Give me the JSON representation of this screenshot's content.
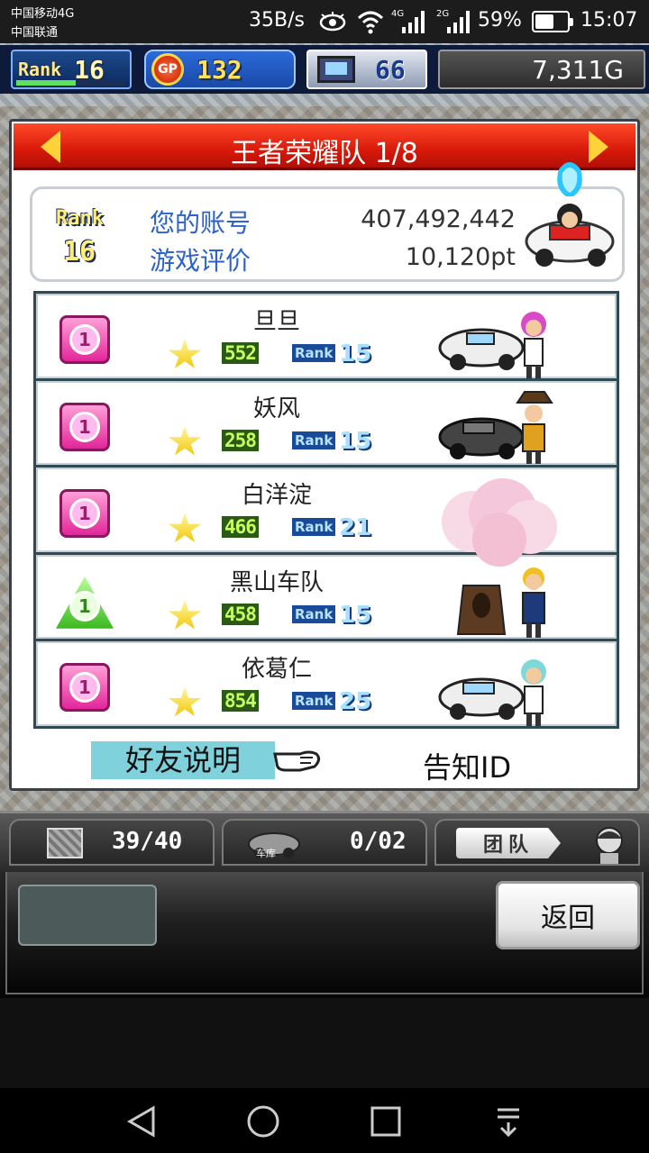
{
  "status_bar": {
    "carrier1": "中国移动4G",
    "carrier2": "中国联通",
    "net_speed": "35B/s",
    "battery_percent": "59%",
    "battery_level": 0.59,
    "clock": "15:07",
    "icons": [
      "eye-icon",
      "wifi-icon",
      "signal-4g-icon",
      "signal-2g-icon",
      "battery-icon"
    ]
  },
  "hud": {
    "rank_label": "Rank",
    "rank_value": "16",
    "rank_progress": 0.55,
    "gp_label": "GP",
    "gp_value": "132",
    "pc_value": "66",
    "gold": "7,311G"
  },
  "dialog": {
    "title": "王者荣耀队 1/8",
    "account": {
      "rank_label": "Rank",
      "rank_value": "16",
      "label_account": "您的账号",
      "label_rating": "游戏评价",
      "account_id": "407,492,442",
      "rating": "10,120pt"
    },
    "friends": [
      {
        "badge": "1",
        "badge_style": "pink",
        "name": "旦旦",
        "score": "552",
        "rank_label": "Rank",
        "rank": "15"
      },
      {
        "badge": "1",
        "badge_style": "pink",
        "name": "妖风",
        "score": "258",
        "rank_label": "Rank",
        "rank": "15"
      },
      {
        "badge": "1",
        "badge_style": "pink",
        "name": "白洋淀",
        "score": "466",
        "rank_label": "Rank",
        "rank": "21"
      },
      {
        "badge": "1",
        "badge_style": "green",
        "name": "黑山车队",
        "score": "458",
        "rank_label": "Rank",
        "rank": "15"
      },
      {
        "badge": "1",
        "badge_style": "pink",
        "name": "依葛仁",
        "score": "854",
        "rank_label": "Rank",
        "rank": "25"
      }
    ],
    "friend_help": "好友说明",
    "notify_id": "告知ID"
  },
  "lower_bar": {
    "slot1_value": "39/40",
    "garage_label": "车库",
    "slot2_value": "0/02",
    "team_label": "团队"
  },
  "bottom_panel": {
    "back_label": "返回"
  },
  "colors": {
    "title_red": "#d81a0a",
    "accent_blue": "#2d62c8",
    "help_cyan": "#7fd1dc",
    "list_border": "#2e4a54"
  }
}
